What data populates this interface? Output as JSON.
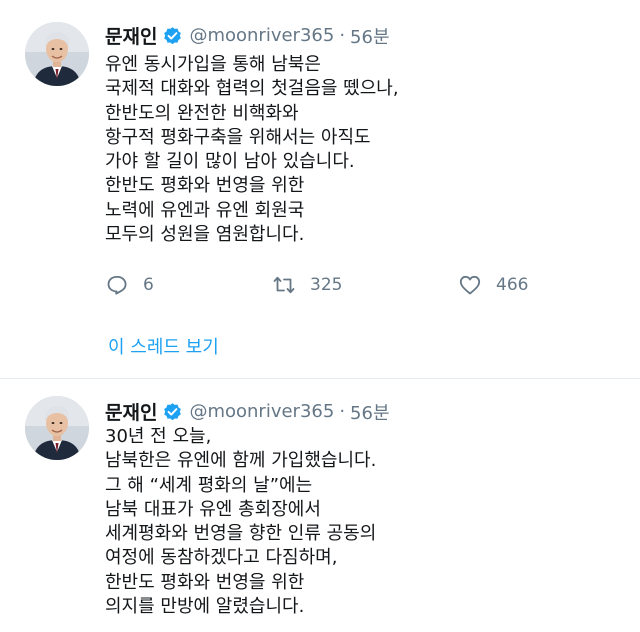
{
  "tweets": [
    {
      "author": {
        "name": "문재인",
        "handle": "@moonriver365",
        "verified": true
      },
      "separator": "·",
      "time": "56분",
      "lines": [
        "유엔 동시가입을 통해 남북은",
        "국제적 대화와 협력의 첫걸음을 뗐으나,",
        "한반도의 완전한 비핵화와",
        "항구적 평화구축을 위해서는 아직도",
        "가야 할 길이 많이 남아 있습니다.",
        "한반도 평화와 번영을 위한",
        "노력에 유엔과 유엔 회원국",
        "모두의 성원을 염원합니다."
      ],
      "stats": {
        "replies": "6",
        "retweets": "325",
        "likes": "466"
      },
      "thread_link": "이 스레드 보기"
    },
    {
      "author": {
        "name": "문재인",
        "handle": "@moonriver365",
        "verified": true
      },
      "separator": "·",
      "time": "56분",
      "lines": [
        "30년 전 오늘,",
        "남북한은 유엔에 함께 가입했습니다.",
        "그 해 “세계 평화의 날”에는",
        "남북 대표가 유엔 총회장에서",
        "세계평화와 번영을 향한 인류 공동의",
        "여정에 동참하겠다고 다짐하며,",
        "한반도 평화와 번영을 위한",
        "의지를 만방에 알렸습니다."
      ]
    }
  ],
  "icons": {
    "verified": "verified-badge-icon",
    "reply": "reply-icon",
    "retweet": "retweet-icon",
    "like": "heart-icon"
  },
  "colors": {
    "accent": "#1da1f2",
    "muted": "#657786",
    "text": "#14171a",
    "divider": "#e6ecf0"
  }
}
